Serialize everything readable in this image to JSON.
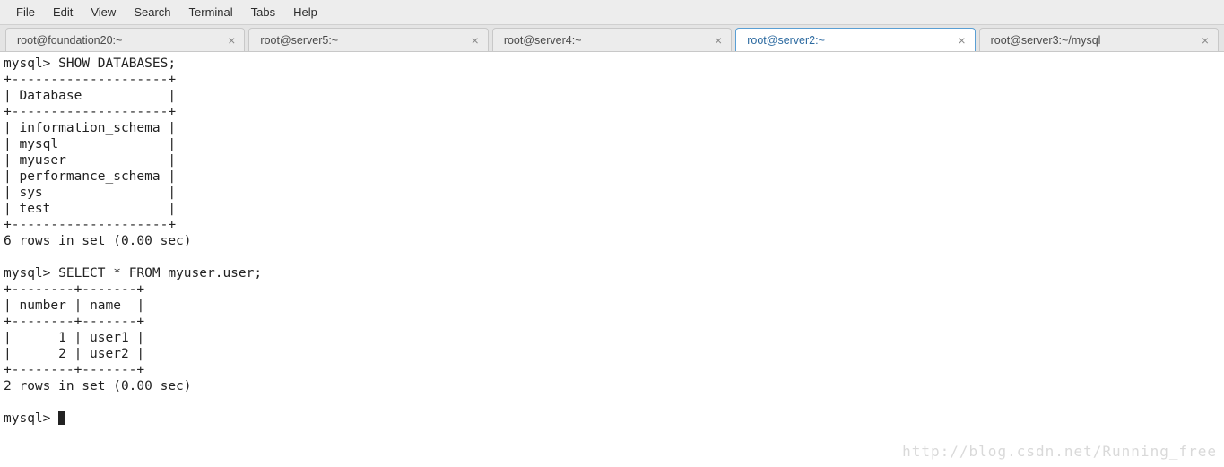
{
  "menubar": {
    "items": [
      "File",
      "Edit",
      "View",
      "Search",
      "Terminal",
      "Tabs",
      "Help"
    ]
  },
  "tabs": [
    {
      "label": "root@foundation20:~",
      "active": false
    },
    {
      "label": "root@server5:~",
      "active": false
    },
    {
      "label": "root@server4:~",
      "active": false
    },
    {
      "label": "root@server2:~",
      "active": true
    },
    {
      "label": "root@server3:~/mysql",
      "active": false
    }
  ],
  "terminal": {
    "prompt": "mysql>",
    "query1": "SHOW DATABASES;",
    "result1": {
      "header": "Database",
      "rows": [
        "information_schema",
        "mysql",
        "myuser",
        "performance_schema",
        "sys",
        "test"
      ],
      "footer": "6 rows in set (0.00 sec)"
    },
    "query2": "SELECT * FROM myuser.user;",
    "result2": {
      "headers": [
        "number",
        "name"
      ],
      "rows": [
        {
          "number": "1",
          "name": "user1"
        },
        {
          "number": "2",
          "name": "user2"
        }
      ],
      "footer": "2 rows in set (0.00 sec)"
    }
  },
  "watermark": "http://blog.csdn.net/Running_free"
}
